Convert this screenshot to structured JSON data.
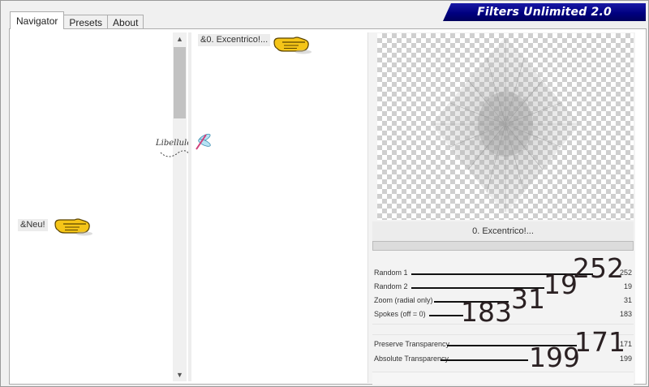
{
  "header": {
    "title": "Filters Unlimited 2.0"
  },
  "tabs": [
    {
      "label": "Navigator",
      "active": true
    },
    {
      "label": "Presets",
      "active": false
    },
    {
      "label": "About",
      "active": false
    }
  ],
  "navigator": {
    "category": "&Neu!",
    "filter_entry": "&0. Excentrico!..."
  },
  "watermark": "Libellule",
  "preview": {
    "filter_name": "0. Excentrico!..."
  },
  "parameters": [
    {
      "label": "Random 1",
      "value": "252",
      "annotation": "252"
    },
    {
      "label": "Random 2",
      "value": "19",
      "annotation": "19"
    },
    {
      "label": "Zoom (radial only)",
      "value": "31",
      "annotation": "31"
    },
    {
      "label": "Spokes (off = 0)",
      "value": "183",
      "annotation": "183"
    },
    {
      "label": "Preserve Transparency",
      "value": "171",
      "annotation": "171"
    },
    {
      "label": "Absolute  Transparency",
      "value": "199",
      "annotation": "199"
    }
  ],
  "icons": {
    "pointer": "pointing-hand-icon",
    "watermark": "dragonfly-icon"
  },
  "colors": {
    "banner": "#000080",
    "hand": "#f5c518"
  }
}
